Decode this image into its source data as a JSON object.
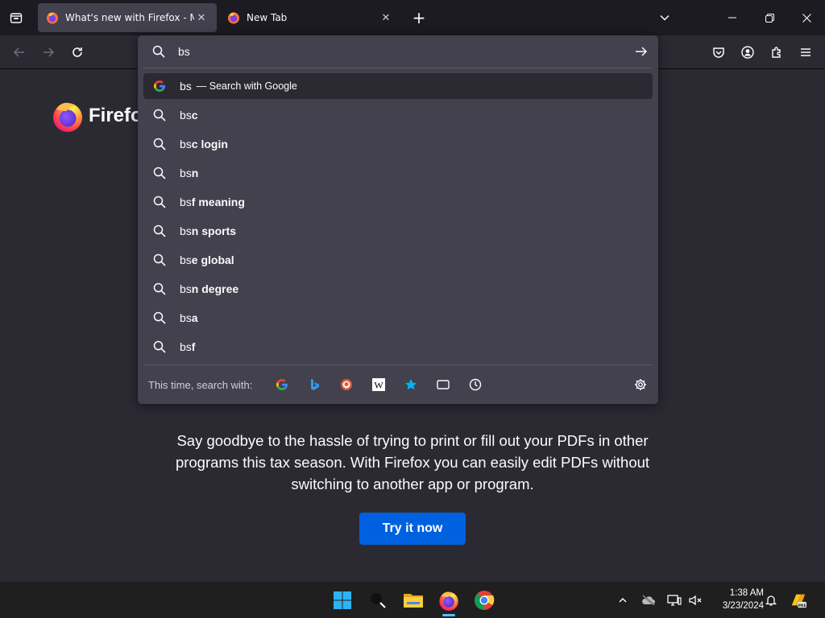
{
  "tabs": [
    {
      "title": "What's new with Firefox - More",
      "active": true,
      "favicon": "firefox-icon"
    },
    {
      "title": "New Tab",
      "active": false,
      "favicon": "firefox-icon"
    }
  ],
  "urlbar": {
    "value": "bs",
    "heuristic": {
      "typed": "bs",
      "action": "— Search with Google",
      "icon": "google-icon"
    },
    "suggestions": [
      {
        "typed": "bs",
        "rest": "c"
      },
      {
        "typed": "bs",
        "rest": "c login"
      },
      {
        "typed": "bs",
        "rest": "n"
      },
      {
        "typed": "bs",
        "rest": "f meaning"
      },
      {
        "typed": "bs",
        "rest": "n sports"
      },
      {
        "typed": "bs",
        "rest": "e global"
      },
      {
        "typed": "bs",
        "rest": "n degree"
      },
      {
        "typed": "bs",
        "rest": "a"
      },
      {
        "typed": "bs",
        "rest": "f"
      }
    ],
    "oneoff_label": "This time, search with:",
    "oneoff_engines": [
      "google-icon",
      "bing-icon",
      "duckduckgo-icon",
      "wikipedia-icon",
      "bookmarks-icon",
      "tabs-icon",
      "history-icon"
    ]
  },
  "page": {
    "logo_text": "Firefox",
    "promo_text": "Say goodbye to the hassle of trying to print or fill out your PDFs in other programs this tax season. With Firefox you can easily edit PDFs without switching to another app or program.",
    "cta_label": "Try it now"
  },
  "taskbar": {
    "time": "1:38 AM",
    "date": "3/23/2024"
  },
  "colors": {
    "accent": "#0061e0",
    "popup_bg": "#42414d",
    "page_bg": "#2b2a33",
    "tabstrip_bg": "#1c1b22"
  }
}
